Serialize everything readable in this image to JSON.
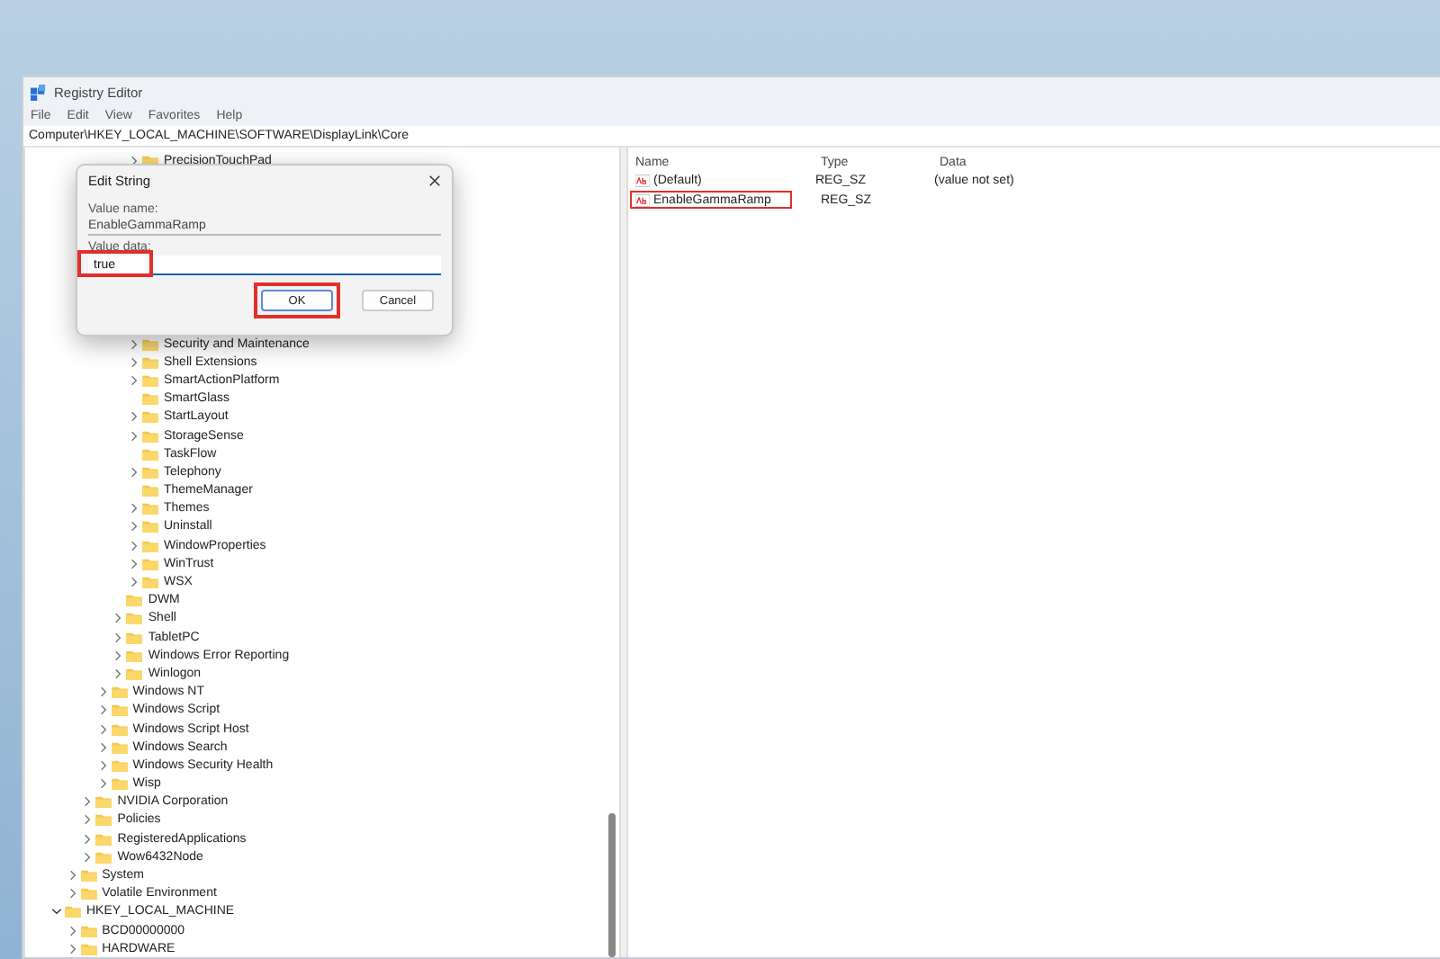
{
  "window": {
    "title": "Registry Editor"
  },
  "menu": [
    "File",
    "Edit",
    "View",
    "Favorites",
    "Help"
  ],
  "address": "Computer\\HKEY_LOCAL_MACHINE\\SOFTWARE\\DisplayLink\\Core",
  "tree": [
    {
      "children": [
        {
          "children": [
            {
              "children": [
                {
                  "children": [
                    {
                      "children": [
                        {
                          "label": "PrecisionTouchPad",
                          "has_children": true,
                          "expanded": false
                        },
                        {
                          "label": "Security and Maintenance",
                          "has_children": true,
                          "expanded": false
                        },
                        {
                          "label": "Shell Extensions",
                          "has_children": true,
                          "expanded": false
                        },
                        {
                          "label": "SmartActionPlatform",
                          "has_children": true,
                          "expanded": false
                        },
                        {
                          "label": "SmartGlass",
                          "has_children": false,
                          "expanded": false
                        },
                        {
                          "label": "StartLayout",
                          "has_children": true,
                          "expanded": false
                        },
                        {
                          "label": "StorageSense",
                          "has_children": true,
                          "expanded": false
                        },
                        {
                          "label": "TaskFlow",
                          "has_children": false,
                          "expanded": false
                        },
                        {
                          "label": "Telephony",
                          "has_children": true,
                          "expanded": false
                        },
                        {
                          "label": "ThemeManager",
                          "has_children": false,
                          "expanded": false
                        },
                        {
                          "label": "Themes",
                          "has_children": true,
                          "expanded": false
                        },
                        {
                          "label": "Uninstall",
                          "has_children": true,
                          "expanded": false
                        },
                        {
                          "label": "WindowProperties",
                          "has_children": true,
                          "expanded": false
                        },
                        {
                          "label": "WinTrust",
                          "has_children": true,
                          "expanded": false
                        },
                        {
                          "label": "WSX",
                          "has_children": true,
                          "expanded": false
                        }
                      ]
                    },
                    {
                      "label": "DWM",
                      "has_children": false,
                      "expanded": false
                    },
                    {
                      "label": "Shell",
                      "has_children": true,
                      "expanded": false
                    },
                    {
                      "label": "TabletPC",
                      "has_children": true,
                      "expanded": false
                    },
                    {
                      "label": "Windows Error Reporting",
                      "has_children": true,
                      "expanded": false
                    },
                    {
                      "label": "Winlogon",
                      "has_children": true,
                      "expanded": false
                    }
                  ]
                },
                {
                  "label": "Windows NT",
                  "has_children": true,
                  "expanded": false
                },
                {
                  "label": "Windows Script",
                  "has_children": true,
                  "expanded": false
                },
                {
                  "label": "Windows Script Host",
                  "has_children": true,
                  "expanded": false
                },
                {
                  "label": "Windows Search",
                  "has_children": true,
                  "expanded": false
                },
                {
                  "label": "Windows Security Health",
                  "has_children": true,
                  "expanded": false
                },
                {
                  "label": "Wisp",
                  "has_children": true,
                  "expanded": false
                }
              ]
            },
            {
              "label": "NVIDIA Corporation",
              "has_children": true,
              "expanded": false
            },
            {
              "label": "Policies",
              "has_children": true,
              "expanded": false
            },
            {
              "label": "RegisteredApplications",
              "has_children": true,
              "expanded": false
            },
            {
              "label": "Wow6432Node",
              "has_children": true,
              "expanded": false
            }
          ]
        },
        {
          "label": "System",
          "has_children": true,
          "expanded": false
        },
        {
          "label": "Volatile Environment",
          "has_children": true,
          "expanded": false
        }
      ]
    },
    {
      "label": "HKEY_LOCAL_MACHINE",
      "has_children": true,
      "expanded": true,
      "children": [
        {
          "label": "BCD00000000",
          "has_children": true,
          "expanded": false
        },
        {
          "label": "HARDWARE",
          "has_children": true,
          "expanded": false
        }
      ]
    }
  ],
  "columns": [
    "Name",
    "Type",
    "Data"
  ],
  "values": [
    {
      "name": "(Default)",
      "type": "REG_SZ",
      "data": "(value not set)",
      "highlighted": false
    },
    {
      "name": "EnableGammaRamp",
      "type": "REG_SZ",
      "highlighted": true
    }
  ],
  "dialog": {
    "title": "Edit String",
    "value_name_label": "Value name:",
    "value_name": "EnableGammaRamp",
    "value_data_label": "Value data:",
    "value_data": "true",
    "value_data_highlighted": true,
    "buttons": [
      {
        "label": "OK",
        "default": true,
        "highlighted": true
      },
      {
        "label": "Cancel",
        "default": false,
        "highlighted": false
      }
    ]
  }
}
